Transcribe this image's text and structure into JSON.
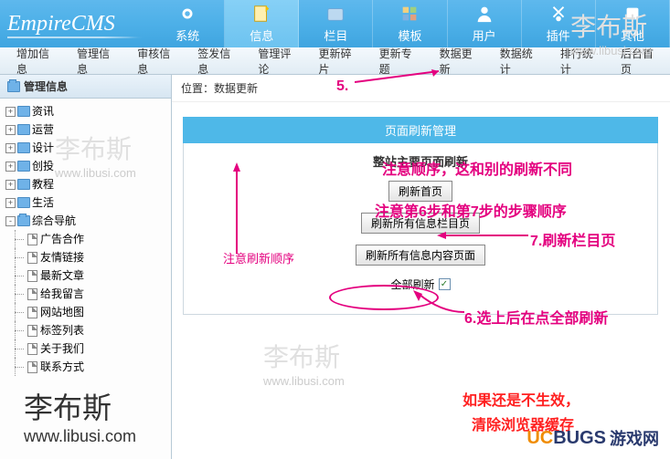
{
  "logo": "EmpireCMS",
  "menu": {
    "items": [
      {
        "label": "系统"
      },
      {
        "label": "信息"
      },
      {
        "label": "栏目"
      },
      {
        "label": "模板"
      },
      {
        "label": "用户"
      },
      {
        "label": "插件"
      },
      {
        "label": "其他"
      }
    ]
  },
  "submenu": {
    "items": [
      {
        "label": "增加信息"
      },
      {
        "label": "管理信息"
      },
      {
        "label": "审核信息"
      },
      {
        "label": "签发信息"
      },
      {
        "label": "管理评论"
      },
      {
        "label": "更新碎片"
      },
      {
        "label": "更新专题"
      },
      {
        "label": "数据更新"
      },
      {
        "label": "数据统计"
      },
      {
        "label": "排行统计"
      },
      {
        "label": "后台首页"
      }
    ]
  },
  "sidebar": {
    "title": "管理信息",
    "nodes": [
      {
        "label": "资讯",
        "expand": "+"
      },
      {
        "label": "运营",
        "expand": "+"
      },
      {
        "label": "设计",
        "expand": "+"
      },
      {
        "label": "创投",
        "expand": "+"
      },
      {
        "label": "教程",
        "expand": "+"
      },
      {
        "label": "生活",
        "expand": "+"
      },
      {
        "label": "综合导航",
        "expand": "-",
        "children": [
          {
            "label": "广告合作"
          },
          {
            "label": "友情链接"
          },
          {
            "label": "最新文章"
          },
          {
            "label": "给我留言"
          },
          {
            "label": "网站地图"
          },
          {
            "label": "标签列表"
          },
          {
            "label": "关于我们"
          },
          {
            "label": "联系方式"
          }
        ]
      }
    ]
  },
  "breadcrumb": {
    "label": "位置：",
    "value": "数据更新"
  },
  "panel": {
    "title": "页面刷新管理",
    "section": "整站主要页面刷新",
    "btn1": "刷新首页",
    "btn2": "刷新所有信息栏目页",
    "btn3": "刷新所有信息内容页面",
    "check_label": "全部刷新",
    "checked": "✓"
  },
  "anno": {
    "step5": "5.",
    "note_order_title": "注意顺序，这和别的刷新不同",
    "note_order_steps": "注意第6步和第7步的步骤顺序",
    "note_refresh_order": "注意刷新顺序",
    "step7": "7.刷新栏目页",
    "step6": "6.选上后在点全部刷新",
    "note_noeffect1": "如果还是不生效，",
    "note_noeffect2": "清除浏览器缓存"
  },
  "watermark": {
    "name": "李布斯",
    "url": "www.libusi.com"
  },
  "ucbugs": {
    "uc": "UC",
    "bugs": "BUGS",
    "cn": "游戏网"
  }
}
